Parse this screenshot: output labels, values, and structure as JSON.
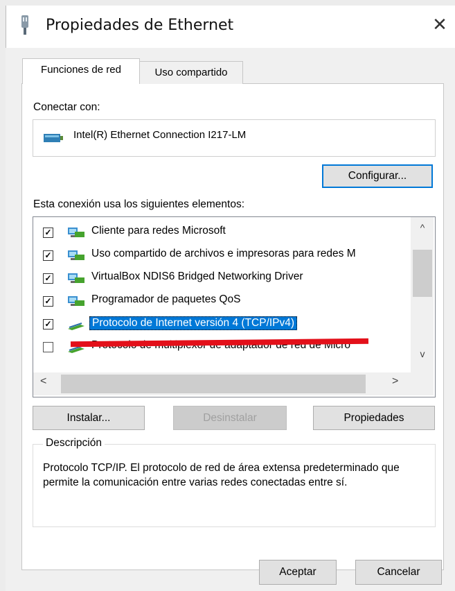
{
  "window": {
    "title": "Propiedades de Ethernet",
    "close_glyph": "✕"
  },
  "tabs": [
    {
      "label": "Funciones de red",
      "active": true
    },
    {
      "label": "Uso compartido",
      "active": false
    }
  ],
  "connect": {
    "label": "Conectar con:",
    "adapter": "Intel(R) Ethernet Connection I217-LM",
    "icon": "network-adapter-icon",
    "configure_button": "Configurar..."
  },
  "elements": {
    "label": "Esta conexión usa los siguientes elementos:",
    "items": [
      {
        "label": "Cliente para redes Microsoft",
        "checked": true,
        "icon": "network-client-icon"
      },
      {
        "label": "Uso compartido de archivos e impresoras para redes M",
        "checked": true,
        "icon": "network-service-icon"
      },
      {
        "label": "VirtualBox NDIS6 Bridged Networking Driver",
        "checked": true,
        "icon": "network-service-icon"
      },
      {
        "label": "Programador de paquetes QoS",
        "checked": true,
        "icon": "network-service-icon"
      },
      {
        "label": "Protocolo de Internet versión 4 (TCP/IPv4)",
        "checked": true,
        "icon": "network-protocol-icon",
        "selected": true
      },
      {
        "label": "Protocolo de multiplexor de adaptador de red de Micro",
        "checked": false,
        "icon": "network-protocol-icon"
      }
    ],
    "scroll_up": "^",
    "scroll_down": "v",
    "scroll_left": "<",
    "scroll_right": ">"
  },
  "buttons": {
    "install": "Instalar...",
    "uninstall": "Desinstalar",
    "properties": "Propiedades",
    "accept": "Aceptar",
    "cancel": "Cancelar"
  },
  "description": {
    "legend": "Descripción",
    "text": "Protocolo TCP/IP. El protocolo de red de área extensa predeterminado que permite la comunicación entre varias redes conectadas entre sí."
  },
  "colors": {
    "selection": "#0078d7",
    "highlight_mark": "#e3101a"
  }
}
